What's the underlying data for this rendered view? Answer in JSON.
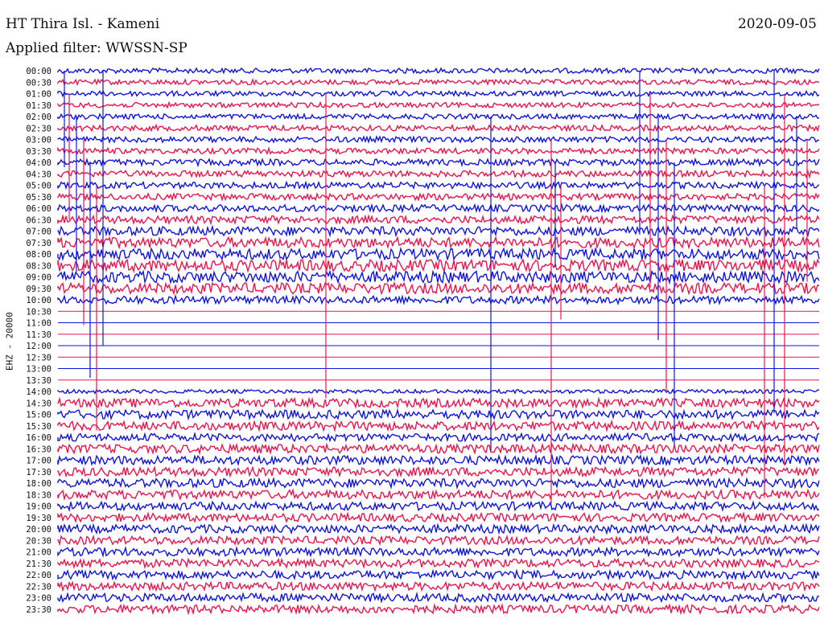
{
  "header": {
    "station": "HT Thira Isl. - Kameni",
    "filter": "Applied filter: WWSSN-SP",
    "date": "2020-09-05"
  },
  "chart_data": {
    "type": "line",
    "title": "HT Thira Isl. - Kameni",
    "subtitle": "Applied filter: WWSSN-SP",
    "date": "2020-09-05",
    "ylabel": "EHZ - 20000",
    "xlabel": "",
    "row_labels": [
      "00:00",
      "00:30",
      "01:00",
      "01:30",
      "02:00",
      "02:30",
      "03:00",
      "03:30",
      "04:00",
      "04:30",
      "05:00",
      "05:30",
      "06:00",
      "06:30",
      "07:00",
      "07:30",
      "08:00",
      "08:30",
      "09:00",
      "09:30",
      "10:00",
      "10:30",
      "11:00",
      "11:30",
      "12:00",
      "12:30",
      "13:00",
      "13:30",
      "14:00",
      "14:30",
      "15:00",
      "15:30",
      "16:00",
      "16:30",
      "17:00",
      "17:30",
      "18:00",
      "18:30",
      "19:00",
      "19:30",
      "20:00",
      "20:30",
      "21:00",
      "21:30",
      "22:00",
      "22:30",
      "23:00",
      "23:30"
    ],
    "row_interval_minutes": 30,
    "series_colors": [
      "#0f14e6",
      "#f0144c"
    ],
    "grid": false,
    "trace_rows": [
      {
        "label": "00:00",
        "noise": 0.4
      },
      {
        "label": "00:30",
        "noise": 0.4
      },
      {
        "label": "01:00",
        "noise": 0.4
      },
      {
        "label": "01:30",
        "noise": 0.4
      },
      {
        "label": "02:00",
        "noise": 0.4
      },
      {
        "label": "02:30",
        "noise": 0.45
      },
      {
        "label": "03:00",
        "noise": 0.45
      },
      {
        "label": "03:30",
        "noise": 0.45
      },
      {
        "label": "04:00",
        "noise": 0.5
      },
      {
        "label": "04:30",
        "noise": 0.5
      },
      {
        "label": "05:00",
        "noise": 0.5
      },
      {
        "label": "05:30",
        "noise": 0.5
      },
      {
        "label": "06:00",
        "noise": 0.55
      },
      {
        "label": "06:30",
        "noise": 0.6
      },
      {
        "label": "07:00",
        "noise": 0.7
      },
      {
        "label": "07:30",
        "noise": 0.8
      },
      {
        "label": "08:00",
        "noise": 0.85
      },
      {
        "label": "08:30",
        "noise": 0.9
      },
      {
        "label": "09:00",
        "noise": 0.9
      },
      {
        "label": "09:30",
        "noise": 0.85
      },
      {
        "label": "10:00",
        "noise": 0.6
      },
      {
        "label": "10:30",
        "noise": 0.0
      },
      {
        "label": "11:00",
        "noise": 0.0
      },
      {
        "label": "11:30",
        "noise": 0.0
      },
      {
        "label": "12:00",
        "noise": 0.0
      },
      {
        "label": "12:30",
        "noise": 0.0
      },
      {
        "label": "13:00",
        "noise": 0.0
      },
      {
        "label": "13:30",
        "noise": 0.0
      },
      {
        "label": "14:00",
        "noise": 0.3
      },
      {
        "label": "14:30",
        "noise": 0.7
      },
      {
        "label": "15:00",
        "noise": 0.7
      },
      {
        "label": "15:30",
        "noise": 0.7
      },
      {
        "label": "16:00",
        "noise": 0.6
      },
      {
        "label": "16:30",
        "noise": 0.7
      },
      {
        "label": "17:00",
        "noise": 0.7
      },
      {
        "label": "17:30",
        "noise": 0.7
      },
      {
        "label": "18:00",
        "noise": 0.7
      },
      {
        "label": "18:30",
        "noise": 0.7
      },
      {
        "label": "19:00",
        "noise": 0.65
      },
      {
        "label": "19:30",
        "noise": 0.65
      },
      {
        "label": "20:00",
        "noise": 0.65
      },
      {
        "label": "20:30",
        "noise": 0.65
      },
      {
        "label": "21:00",
        "noise": 0.65
      },
      {
        "label": "21:30",
        "noise": 0.65
      },
      {
        "label": "22:00",
        "noise": 0.65
      },
      {
        "label": "22:30",
        "noise": 0.65
      },
      {
        "label": "23:00",
        "noise": 0.65
      },
      {
        "label": "23:30",
        "noise": 0.65
      }
    ]
  }
}
